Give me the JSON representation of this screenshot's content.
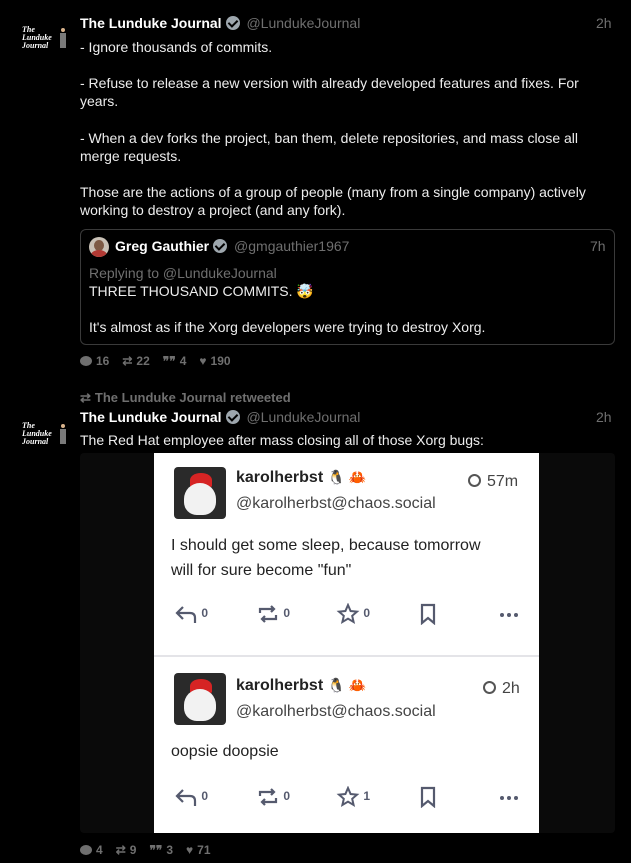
{
  "post1": {
    "name": "The Lunduke Journal",
    "handle": "@LundukeJournal",
    "time": "2h",
    "logo_text": [
      "The",
      "Lunduke",
      "Journal"
    ],
    "lines": [
      "- Ignore thousands of commits.",
      "- Refuse to release a new version with already developed features and fixes.  For",
      "years.",
      "- When a dev forks the project, ban them, delete repositories, and mass close all",
      "merge requests.",
      "Those are the actions of a group of people (many from a single company) actively",
      "working to destroy a project (and any fork)."
    ],
    "quote": {
      "name": "Greg Gauthier",
      "handle": "@gmgauthier1967",
      "time": "7h",
      "replying": "Replying to @LundukeJournal",
      "line1": "THREE THOUSAND COMMITS. 🤯",
      "line2": "It's almost as if the Xorg developers were trying to destroy Xorg."
    },
    "stats": {
      "replies": "16",
      "retweets": "22",
      "quotes": "4",
      "likes": "190"
    }
  },
  "retweet_label": "The Lunduke Journal retweeted",
  "post2": {
    "name": "The Lunduke Journal",
    "handle": "@LundukeJournal",
    "time": "2h",
    "text": "The Red Hat employee after mass closing all of those Xorg bugs:",
    "stats": {
      "replies": "4",
      "retweets": "9",
      "quotes": "3",
      "likes": "71"
    },
    "embedded": {
      "toots": [
        {
          "name": "karolherbst",
          "badges": "🐧 🦀",
          "handle": "@karolherbst@chaos.social",
          "time": "57m",
          "body1": "I should get some sleep, because tomorrow",
          "body2": "will for sure become \"fun\"",
          "reply_count": "0",
          "boost_count": "0",
          "fav_count": "0"
        },
        {
          "name": "karolherbst",
          "badges": "🐧 🦀",
          "handle": "@karolherbst@chaos.social",
          "time": "2h",
          "body1": "oopsie doopsie",
          "reply_count": "0",
          "boost_count": "0",
          "fav_count": "1"
        }
      ]
    }
  }
}
